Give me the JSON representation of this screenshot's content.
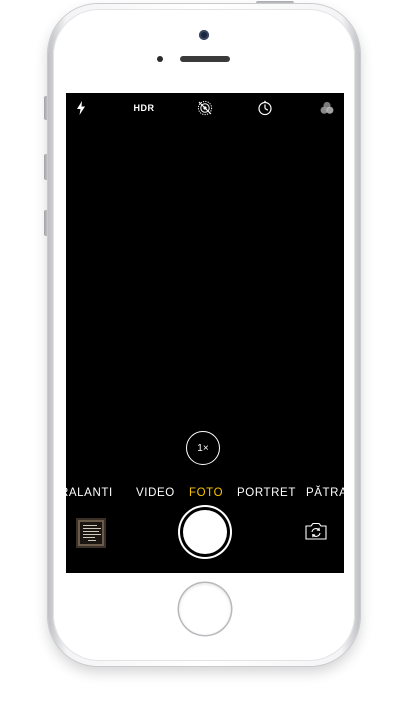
{
  "camera": {
    "top_bar": {
      "flash_icon": "flash-icon",
      "hdr_label": "HDR",
      "live_photo_icon": "live-photo-off-icon",
      "timer_icon": "timer-icon",
      "filters_icon": "filters-icon"
    },
    "zoom_label": "1×",
    "modes": [
      {
        "label": "RALANTI",
        "active": false
      },
      {
        "label": "VIDEO",
        "active": false
      },
      {
        "label": "FOTO",
        "active": true
      },
      {
        "label": "PORTRET",
        "active": false
      },
      {
        "label": "PĂTRAT",
        "active": false
      }
    ],
    "bottom_bar": {
      "thumbnail_icon": "last-photo-thumbnail",
      "shutter_icon": "shutter-button",
      "flip_icon": "flip-camera-icon"
    },
    "colors": {
      "active_mode": "#f7c500",
      "screen_bg": "#000000",
      "controls": "#ffffff"
    }
  }
}
